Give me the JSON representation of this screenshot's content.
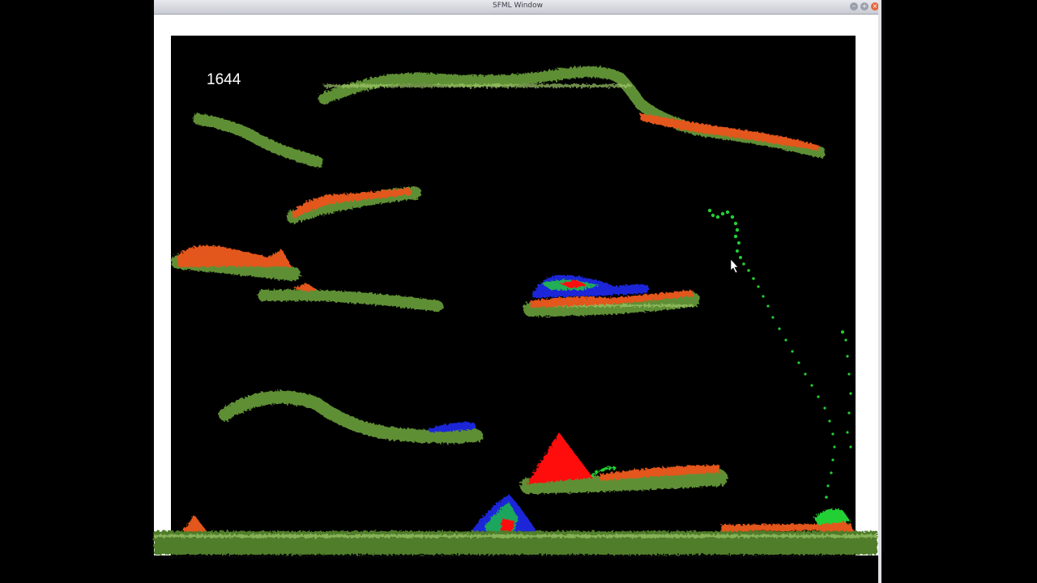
{
  "window": {
    "title": "SFML Window",
    "buttons": {
      "minimize": "–",
      "maximize": "+",
      "close": "×"
    }
  },
  "simulation": {
    "frame_counter": "1644",
    "colors": {
      "background": "#000000",
      "vegetation": "#5e8f34",
      "vegetation_light": "#9fc86a",
      "orange_particles": "#e3571a",
      "red_particles": "#ff1010",
      "blue_particles": "#1a28d8",
      "green_particles": "#22d034"
    }
  }
}
